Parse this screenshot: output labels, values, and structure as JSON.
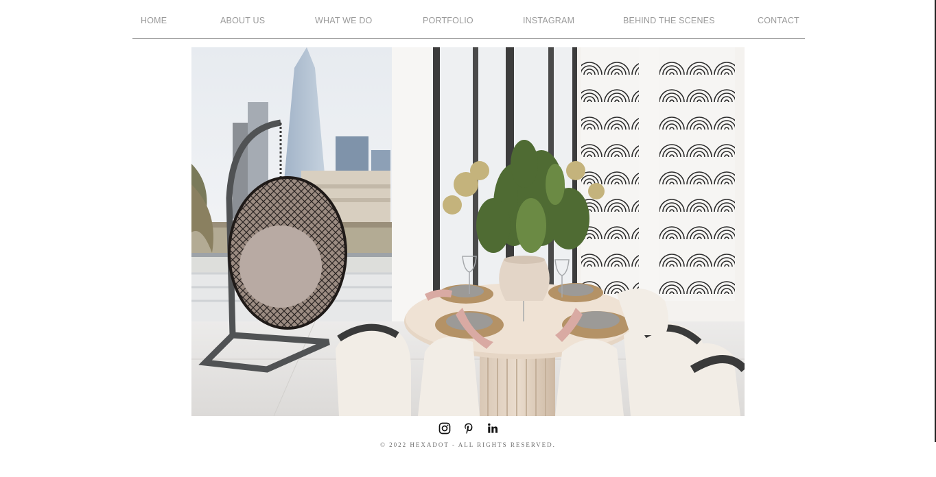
{
  "nav": {
    "items": [
      {
        "label": "HOME"
      },
      {
        "label": "ABOUT US"
      },
      {
        "label": "WHAT WE DO"
      },
      {
        "label": "PORTFOLIO"
      },
      {
        "label": "INSTAGRAM"
      },
      {
        "label": "BEHIND THE SCENES"
      },
      {
        "label": "CONTACT"
      }
    ]
  },
  "hero": {
    "icon": "interior-dining-photo"
  },
  "social": {
    "icons": [
      "instagram-icon",
      "pinterest-icon",
      "linkedin-icon"
    ]
  },
  "footer": {
    "copyright": "© 2022 HEXADOT - ALL RIGHTS RESERVED."
  },
  "colors": {
    "nav_text": "#9a9a9a",
    "divider": "#8a8a8a",
    "footer_text": "#6f6f6f",
    "icon": "#111111"
  }
}
